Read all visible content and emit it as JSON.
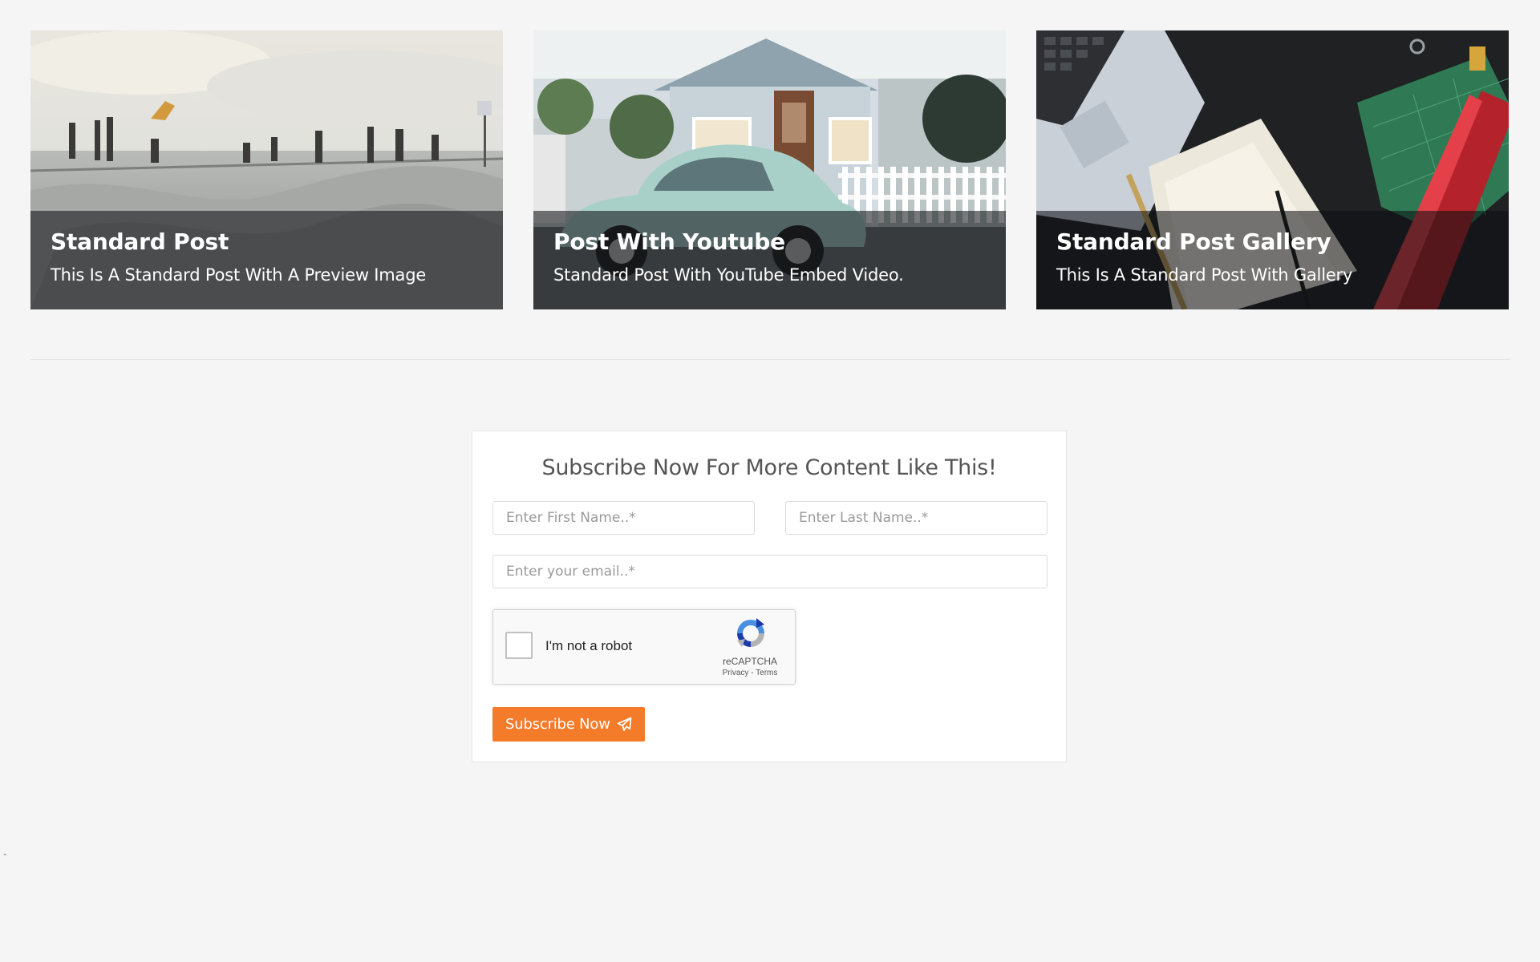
{
  "posts": [
    {
      "title": "Standard Post",
      "description": "This Is A Standard Post With A Preview Image",
      "image": "skatepark-photo"
    },
    {
      "title": "Post With Youtube",
      "description": "Standard Post With YouTube Embed Video.",
      "image": "house-vintage-car-photo"
    },
    {
      "title": "Standard Post Gallery",
      "description": "This Is A Standard Post With Gallery",
      "image": "desk-laptop-notebook-photo"
    }
  ],
  "subscribe": {
    "title": "Subscribe Now For More Content Like This!",
    "first_name_placeholder": "Enter First Name..*",
    "last_name_placeholder": "Enter Last Name..*",
    "email_placeholder": "Enter your email..*",
    "button_label": "Subscribe Now",
    "button_icon": "paper-plane-icon",
    "button_color": "#f47b2a"
  },
  "recaptcha": {
    "label": "I'm not a robot",
    "brand": "reCAPTCHA",
    "privacy": "Privacy",
    "separator": " - ",
    "terms": "Terms"
  },
  "stray_mark": "`"
}
